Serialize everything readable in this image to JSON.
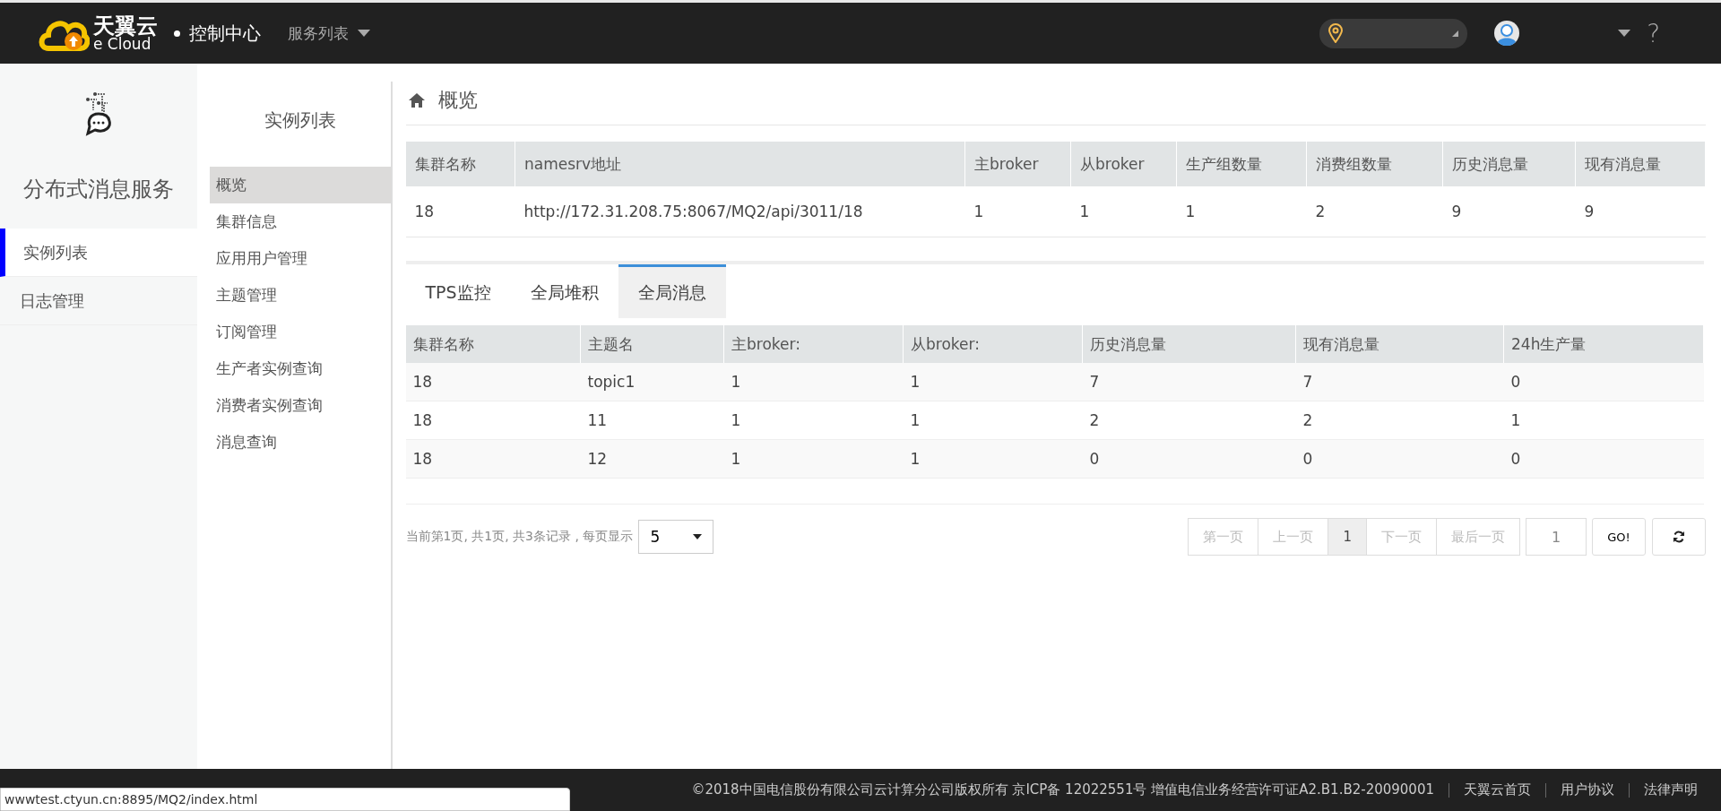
{
  "header": {
    "brand": "天翼云",
    "brand_sub": "e Cloud",
    "title": "控制中心",
    "services": "服务列表",
    "help": "?"
  },
  "sidebar": {
    "title": "分布式消息服务",
    "items": [
      {
        "label": "实例列表",
        "selected": true
      },
      {
        "label": "日志管理",
        "selected": false
      }
    ]
  },
  "subnav": {
    "title": "实例列表",
    "items": [
      {
        "label": "概览",
        "selected": true
      },
      {
        "label": "集群信息",
        "selected": false
      },
      {
        "label": "应用用户管理",
        "selected": false
      },
      {
        "label": "主题管理",
        "selected": false
      },
      {
        "label": "订阅管理",
        "selected": false
      },
      {
        "label": "生产者实例查询",
        "selected": false
      },
      {
        "label": "消费者实例查询",
        "selected": false
      },
      {
        "label": "消息查询",
        "selected": false
      }
    ]
  },
  "page_title": "概览",
  "summary_table": {
    "columns": [
      "集群名称",
      "namesrv地址",
      "主broker",
      "从broker",
      "生产组数量",
      "消费组数量",
      "历史消息量",
      "现有消息量"
    ],
    "rows": [
      [
        "18",
        "http://172.31.208.75:8067/MQ2/api/3011/18",
        "1",
        "1",
        "1",
        "2",
        "9",
        "9"
      ]
    ]
  },
  "tabs": [
    {
      "label": "TPS监控",
      "selected": false
    },
    {
      "label": "全局堆积",
      "selected": false
    },
    {
      "label": "全局消息",
      "selected": true
    }
  ],
  "topic_table": {
    "columns": [
      "集群名称",
      "主题名",
      "主broker:",
      "从broker:",
      "历史消息量",
      "现有消息量",
      "24h生产量"
    ],
    "rows": [
      [
        "18",
        "topic1",
        "1",
        "1",
        "7",
        "7",
        "0"
      ],
      [
        "18",
        "11",
        "1",
        "1",
        "2",
        "2",
        "1"
      ],
      [
        "18",
        "12",
        "1",
        "1",
        "0",
        "0",
        "0"
      ]
    ]
  },
  "pagination": {
    "info": "当前第1页, 共1页, 共3条记录 , 每页显示",
    "page_size": "5",
    "buttons": [
      {
        "label": "第一页",
        "selected": false,
        "disabled": true
      },
      {
        "label": "上一页",
        "selected": false,
        "disabled": true
      },
      {
        "label": "1",
        "selected": true,
        "disabled": false
      },
      {
        "label": "下一页",
        "selected": false,
        "disabled": true
      },
      {
        "label": "最后一页",
        "selected": false,
        "disabled": true
      }
    ],
    "page_input": "1",
    "go": "GO!"
  },
  "footer": {
    "copyright": "©2018中国电信股份有限公司云计算分公司版权所有 京ICP备 12022551号 增值电信业务经营许可证A2.B1.B2-20090001",
    "links": [
      "天翼云首页",
      "用户协议",
      "法律声明"
    ]
  },
  "status_url": "wwwtest.ctyun.cn:8895/MQ2/index.html"
}
